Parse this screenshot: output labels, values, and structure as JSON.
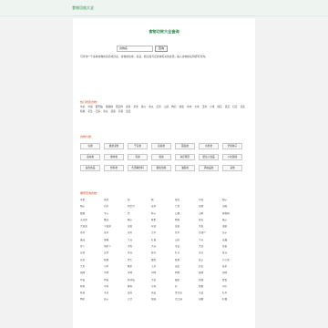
{
  "site": {
    "brand": "食物功效大全"
  },
  "main": {
    "title": "食物功效大全查询",
    "search_value": "食物名",
    "search_button": "查询",
    "intro": "可查询一千多种食物的营养成分表，食物的功效、禁忌、相克和与该食物有关的食谱，输入食物的名称即可查询。"
  },
  "hot": {
    "title": "热门搜索食物：",
    "keywords": [
      "牛奶",
      "鸡蛋",
      "葡萄柚",
      "猕猴桃",
      "西红柿",
      "香蕉",
      "苹果",
      "黄瓜",
      "木瓜",
      "红枣",
      "山药",
      "枸杞",
      "蜂蜜",
      "牛肉",
      "大米",
      "玉米",
      "小米",
      "绿豆",
      "黑豆",
      "红豆",
      "燕麦",
      "核桃",
      "花生",
      "芝麻",
      "南瓜",
      "菠菜",
      "芹菜",
      "生姜"
    ]
  },
  "categories": {
    "title": "食物分类：",
    "items": [
      "谷类",
      "薯类淀粉",
      "干豆类",
      "蔬菜类",
      "菌藻类",
      "水果类",
      "坚果种子",
      "畜肉类",
      "禽肉类",
      "乳类",
      "蛋类",
      "鱼虾蟹贝",
      "婴幼儿食品",
      "小吃甜饼",
      "速食食品",
      "饮料类",
      "含酒精饮料",
      "糖蜜饯类",
      "油脂类",
      "调味品类",
      "其他"
    ]
  },
  "recommend": {
    "title": "推荐查询食物：",
    "items": [
      "苹果",
      "香蕉",
      "梨",
      "桃",
      "葡萄",
      "草莓",
      "橙子",
      "柚子",
      "西瓜",
      "哈密瓜",
      "菠萝",
      "芒果",
      "荔枝",
      "龙眼",
      "樱桃",
      "李子",
      "杏",
      "柿子",
      "石榴",
      "山楂",
      "猕猴桃",
      "火龙果",
      "榴莲",
      "椰子",
      "枇杷",
      "杨梅",
      "甘蔗",
      "橘子",
      "大白菜",
      "小白菜",
      "菠菜",
      "芹菜",
      "韭菜",
      "生菜",
      "油菜",
      "黄瓜",
      "冬瓜",
      "南瓜",
      "苦瓜",
      "丝瓜",
      "西葫芦",
      "茄子",
      "番茄",
      "辣椒",
      "土豆",
      "红薯",
      "山药",
      "芋头",
      "莲藕",
      "萝卜",
      "胡萝卜",
      "洋葱",
      "大蒜",
      "生姜",
      "大葱",
      "香菜",
      "豆腐",
      "豆浆",
      "黄豆",
      "绿豆",
      "红豆",
      "黑豆",
      "蚕豆",
      "花生",
      "核桃",
      "杏仁",
      "腰果",
      "板栗",
      "松子",
      "开心果",
      "大米",
      "小米",
      "糯米",
      "玉米",
      "燕麦",
      "荞麦",
      "薏米",
      "猪肉",
      "牛肉",
      "羊肉",
      "鸡肉",
      "鸭肉",
      "鹅肉",
      "兔肉",
      "鸡蛋",
      "鸭蛋",
      "鹌鹑蛋",
      "牛奶",
      "酸奶",
      "奶酪",
      "蜂蜜",
      "鲤鱼",
      "草鱼",
      "鲫鱼",
      "带鱼",
      "虾",
      "螃蟹",
      "海带",
      "紫菜",
      "木耳",
      "银耳",
      "香菇",
      "金针菇",
      "平菇",
      "红枣",
      "枸杞",
      "莲子",
      "百合",
      "桂圆",
      "黑芝麻",
      "白糖",
      "红糖"
    ]
  }
}
